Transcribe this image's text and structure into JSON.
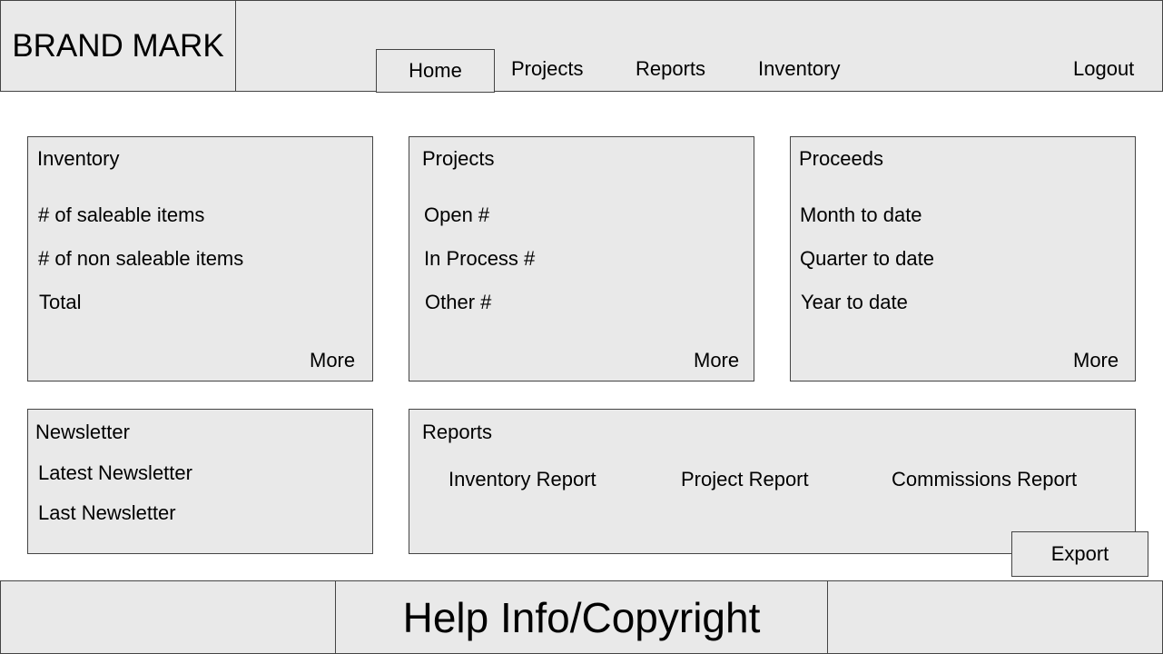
{
  "brand": {
    "label": "BRAND MARK"
  },
  "nav": {
    "home": "Home",
    "projects": "Projects",
    "reports": "Reports",
    "inventory": "Inventory",
    "logout": "Logout"
  },
  "inventory_card": {
    "title": "Inventory",
    "items": [
      "# of saleable items",
      "# of non saleable items",
      "Total"
    ],
    "more": "More"
  },
  "projects_card": {
    "title": "Projects",
    "items": [
      "Open #",
      "In Process #",
      "Other #"
    ],
    "more": "More"
  },
  "proceeds_card": {
    "title": "Proceeds",
    "items": [
      "Month to date",
      "Quarter to date",
      "Year to date"
    ],
    "more": "More"
  },
  "newsletter_card": {
    "title": "Newsletter",
    "items": [
      "Latest Newsletter",
      "Last Newsletter"
    ]
  },
  "reports_card": {
    "title": "Reports",
    "links": [
      "Inventory Report",
      "Project Report",
      "Commissions Report"
    ],
    "export": "Export"
  },
  "footer": {
    "help": "Help Info/Copyright"
  }
}
